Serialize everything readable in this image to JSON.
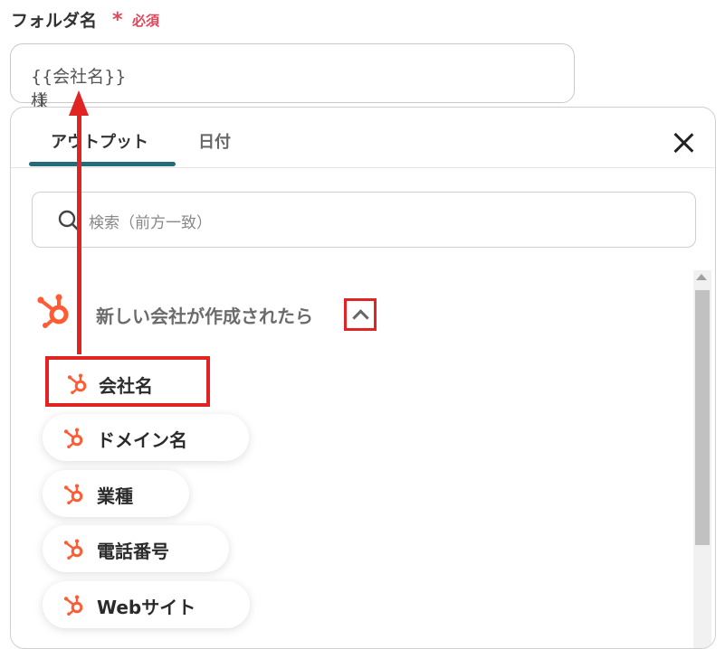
{
  "field": {
    "label": "フォルダ名",
    "required_star": "*",
    "required_text": "必須",
    "value": "{{会社名}}様"
  },
  "tabs": [
    {
      "label": "アウトプット",
      "active": true
    },
    {
      "label": "日付",
      "active": false
    }
  ],
  "search": {
    "placeholder": "検索（前方一致）"
  },
  "group": {
    "label": "新しい会社が作成されたら",
    "icon": "hubspot-icon",
    "expanded": true
  },
  "items": [
    {
      "label": "会社名",
      "icon": "hubspot-icon"
    },
    {
      "label": "ドメイン名",
      "icon": "hubspot-icon"
    },
    {
      "label": "業種",
      "icon": "hubspot-icon"
    },
    {
      "label": "電話番号",
      "icon": "hubspot-icon"
    },
    {
      "label": "Webサイト",
      "icon": "hubspot-icon"
    }
  ],
  "colors": {
    "accent": "#246a78",
    "required": "#e0455a",
    "annotation": "#e02424",
    "hubspot": "#ff5c35"
  }
}
